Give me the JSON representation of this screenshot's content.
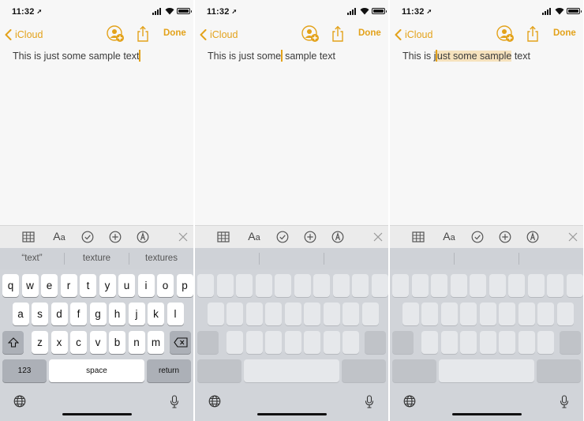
{
  "panels": [
    {
      "status": {
        "time": "11:32"
      },
      "nav": {
        "back_label": "iCloud",
        "done_label": "Done"
      },
      "note": {
        "before": "This is just some sample text",
        "selected": "",
        "after": "",
        "caret": "end"
      },
      "suggestions": [
        "“text”",
        "texture",
        "textures"
      ],
      "keyboard": {
        "row1": [
          "q",
          "w",
          "e",
          "r",
          "t",
          "y",
          "u",
          "i",
          "o",
          "p"
        ],
        "row2": [
          "a",
          "s",
          "d",
          "f",
          "g",
          "h",
          "j",
          "k",
          "l"
        ],
        "row3": [
          "z",
          "x",
          "c",
          "v",
          "b",
          "n",
          "m"
        ],
        "numbers_label": "123",
        "space_label": "space",
        "return_label": "return"
      }
    },
    {
      "status": {
        "time": "11:32"
      },
      "nav": {
        "back_label": "iCloud",
        "done_label": "Done"
      },
      "note": {
        "before": "This is just some",
        "selected": "",
        "after": " sample text",
        "caret": "middle"
      }
    },
    {
      "status": {
        "time": "11:32"
      },
      "nav": {
        "back_label": "iCloud",
        "done_label": "Done"
      },
      "note": {
        "before": "This is j",
        "selected": "ust some sample",
        "after": " text",
        "caret": "selection"
      }
    }
  ],
  "icons": {
    "status": [
      "location-arrow-icon",
      "cellular-signal-icon",
      "wifi-icon",
      "battery-icon"
    ],
    "nav": [
      "chevron-left-icon",
      "add-people-icon",
      "share-icon"
    ],
    "toolbar": [
      "table-icon",
      "text-format-icon",
      "checklist-icon",
      "plus-circle-icon",
      "markup-pen-icon",
      "close-icon"
    ],
    "keyboard": [
      "shift-icon",
      "delete-icon",
      "globe-icon",
      "microphone-icon"
    ]
  },
  "colors": {
    "accent": "#e3a21a",
    "selection": "#f6e2bd",
    "keyboard_bg": "#d1d4d9",
    "note_bg": "#f7f7f7"
  }
}
